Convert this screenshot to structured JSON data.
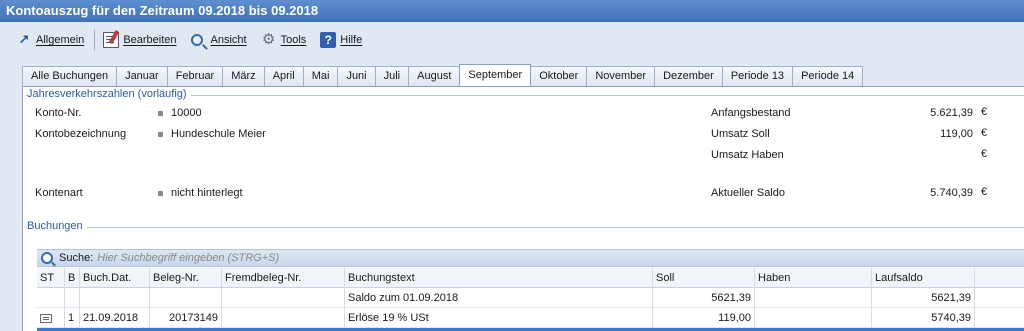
{
  "window": {
    "title": "Kontoauszug für den Zeitraum 09.2018 bis 09.2018"
  },
  "toolbar": {
    "items": [
      {
        "label": "Allgemein",
        "icon": "arrow-icon"
      },
      {
        "label": "Bearbeiten",
        "icon": "edit-document-icon"
      },
      {
        "label": "Ansicht",
        "icon": "view-magnifier-icon"
      },
      {
        "label": "Tools",
        "icon": "gear-icon"
      },
      {
        "label": "Hilfe",
        "icon": "help-icon"
      }
    ]
  },
  "tabs": [
    {
      "label": "Alle Buchungen"
    },
    {
      "label": "Januar"
    },
    {
      "label": "Februar"
    },
    {
      "label": "März"
    },
    {
      "label": "April"
    },
    {
      "label": "Mai"
    },
    {
      "label": "Juni"
    },
    {
      "label": "Juli"
    },
    {
      "label": "August"
    },
    {
      "label": "September",
      "active": true
    },
    {
      "label": "Oktober"
    },
    {
      "label": "November"
    },
    {
      "label": "Dezember"
    },
    {
      "label": "Periode 13"
    },
    {
      "label": "Periode 14"
    }
  ],
  "summary": {
    "group_title": "Jahresverkehrszahlen (vorläufig)",
    "konto_nr_label": "Konto-Nr.",
    "konto_nr_value": "10000",
    "kontobezeichnung_label": "Kontobezeichnung",
    "kontobezeichnung_value": "Hundeschule Meier",
    "kontenart_label": "Kontenart",
    "kontenart_value": "nicht hinterlegt",
    "anfangsbestand_label": "Anfangsbestand",
    "anfangsbestand_value": "5.621,39",
    "umsatz_soll_label": "Umsatz Soll",
    "umsatz_soll_value": "119,00",
    "umsatz_haben_label": "Umsatz Haben",
    "umsatz_haben_value": "",
    "aktueller_saldo_label": "Aktueller Saldo",
    "aktueller_saldo_value": "5.740,39",
    "currency": "€"
  },
  "bookings": {
    "group_title": "Buchungen",
    "search_label": "Suche:",
    "search_placeholder": "Hier Suchbegriff eingeben (STRG+S)",
    "columns": [
      "ST",
      "B",
      "Buch.Dat.",
      "Beleg-Nr.",
      "Fremdbeleg-Nr.",
      "Buchungstext",
      "Soll",
      "Haben",
      "Laufsaldo"
    ],
    "rows": [
      {
        "st": "",
        "b": "",
        "date": "",
        "beleg": "",
        "fremdbeleg": "",
        "text": "Saldo zum 01.09.2018",
        "soll": "5621,39",
        "haben": "",
        "laufsaldo": "5621,39"
      },
      {
        "st": "doc-icon",
        "b": "1",
        "date": "21.09.2018",
        "beleg": "20173149",
        "fremdbeleg": "",
        "text": "Erlöse 19 % USt",
        "soll": "119,00",
        "haben": "",
        "laufsaldo": "5740,39"
      }
    ]
  },
  "colors": {
    "titlebar": "#3f70b8",
    "accent": "#2c5aa0",
    "selection": "#3c78d0",
    "background": "#dfe8f3"
  }
}
